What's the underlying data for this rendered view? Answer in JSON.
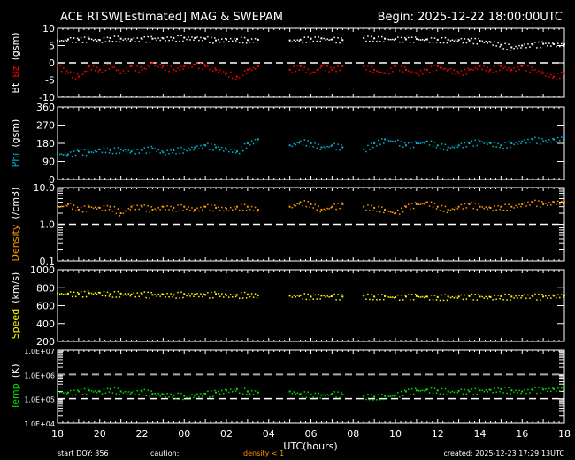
{
  "title": "ACE RTSW[Estimated] MAG & SWEPAM",
  "begin": "Begin: 2025-12-22 18:00:00UTC",
  "footer": {
    "start_doy": "start DOY: 356",
    "caution": "caution:",
    "caution_note": "density < 1",
    "created": "created: 2025-12-23 17:29:13UTC"
  },
  "colors": {
    "bt": "#ffffff",
    "bz": "#ff0000",
    "phi": "#00b4d0",
    "density": "#ff9900",
    "speed": "#ffff00",
    "temp": "#00e000",
    "caution": "#ff9900"
  },
  "chart_data": {
    "type": "scatter",
    "xlabel": "UTC(hours)",
    "x_tick_labels": [
      "18",
      "20",
      "22",
      "00",
      "02",
      "04",
      "06",
      "08",
      "10",
      "12",
      "14",
      "16",
      "18"
    ],
    "x_range": [
      "2025-12-22 18:00",
      "2025-12-23 18:00"
    ],
    "x": [
      "18:00",
      "18:30",
      "19:00",
      "19:30",
      "20:00",
      "20:30",
      "21:00",
      "21:30",
      "22:00",
      "22:30",
      "23:00",
      "23:30",
      "00:00",
      "00:30",
      "01:00",
      "01:30",
      "02:00",
      "02:30",
      "03:00",
      "03:30",
      "04:00",
      "04:30",
      "05:00",
      "05:30",
      "06:00",
      "06:30",
      "07:00",
      "07:30",
      "08:00",
      "08:30",
      "09:00",
      "09:30",
      "10:00",
      "10:30",
      "11:00",
      "11:30",
      "12:00",
      "12:30",
      "13:00",
      "13:30",
      "14:00",
      "14:30",
      "15:00",
      "15:30",
      "16:00",
      "16:30",
      "17:00",
      "17:30",
      "18:00"
    ],
    "panels": [
      {
        "ylabel_parts": [
          "Bt",
          "Bz",
          "(gsm)"
        ],
        "ylim": [
          -10,
          10
        ],
        "scale": "linear",
        "yticks": [
          "10",
          "5",
          "0",
          "-5",
          "-10"
        ],
        "tick_values": [
          10,
          5,
          0,
          -5,
          -10
        ],
        "dashed_line": 0,
        "series": [
          {
            "name": "Bt",
            "color_key": "bt",
            "values": [
              6.5,
              6.8,
              6.7,
              7.0,
              6.6,
              7.2,
              7.0,
              6.8,
              6.9,
              7.0,
              7.1,
              7.2,
              7.3,
              7.2,
              7.0,
              6.5,
              6.8,
              6.9,
              6.6,
              6.7,
              null,
              null,
              6.5,
              6.7,
              7.0,
              7.1,
              6.8,
              6.6,
              null,
              7.2,
              7.1,
              7.0,
              6.9,
              6.8,
              6.9,
              6.8,
              6.7,
              6.7,
              6.6,
              6.5,
              6.4,
              6.0,
              5.2,
              4.5,
              5.0,
              5.3,
              5.5,
              5.4,
              5.3
            ]
          },
          {
            "name": "Bz",
            "color_key": "bz",
            "values": [
              -1,
              -3,
              -4,
              -1,
              -2,
              -0.5,
              -3,
              -1,
              -2,
              0,
              -1,
              -2,
              -1,
              -0.5,
              -1,
              -2,
              -3,
              -4,
              -2,
              -1,
              null,
              null,
              -2,
              -1,
              -3,
              -1,
              -2,
              -1,
              null,
              -1,
              -2,
              -3,
              -1,
              -2,
              -3,
              -2,
              -1,
              -2,
              -3,
              -2,
              -1,
              -2,
              -1,
              -2,
              -1,
              -2,
              -3,
              -4,
              -3
            ]
          }
        ]
      },
      {
        "ylabel_parts": [
          "Phi",
          "(gsm)"
        ],
        "ylim": [
          0,
          360
        ],
        "scale": "linear",
        "yticks": [
          "360",
          "270",
          "180",
          "90",
          "0"
        ],
        "tick_values": [
          360,
          270,
          180,
          90,
          0
        ],
        "series": [
          {
            "name": "Phi",
            "color_key": "phi",
            "values": [
              130,
              125,
              140,
              135,
              150,
              145,
              150,
              140,
              145,
              155,
              135,
              145,
              150,
              160,
              170,
              160,
              150,
              140,
              180,
              200,
              null,
              null,
              170,
              190,
              180,
              160,
              170,
              160,
              null,
              150,
              180,
              200,
              190,
              170,
              180,
              190,
              170,
              160,
              170,
              180,
              190,
              180,
              170,
              180,
              190,
              200,
              190,
              200,
              210
            ]
          }
        ]
      },
      {
        "ylabel_parts": [
          "Density",
          "(/cm3)"
        ],
        "ylim": [
          0.1,
          10
        ],
        "scale": "log",
        "yticks": [
          "10.0",
          "1.0",
          "0.1"
        ],
        "tick_values": [
          10,
          1,
          0.1
        ],
        "dashed_line": 1,
        "series": [
          {
            "name": "Density",
            "color_key": "density",
            "values": [
              3,
              3.5,
              2.5,
              3,
              2.8,
              3,
              2,
              3,
              3,
              2.5,
              3,
              2.8,
              3,
              2.5,
              3,
              2.8,
              2.6,
              3,
              3,
              2.5,
              null,
              null,
              3,
              4,
              3.5,
              2.5,
              3,
              3.5,
              null,
              3,
              2.8,
              2.5,
              2,
              3,
              3.5,
              4,
              3,
              2.5,
              3,
              3.5,
              3,
              2.8,
              3,
              3,
              3.5,
              4,
              3.5,
              4,
              4
            ]
          }
        ]
      },
      {
        "ylabel_parts": [
          "Speed",
          "(km/s)"
        ],
        "ylim": [
          200,
          1000
        ],
        "scale": "linear",
        "yticks": [
          "1000",
          "800",
          "600",
          "400",
          "200"
        ],
        "tick_values": [
          1000,
          800,
          600,
          400,
          200
        ],
        "series": [
          {
            "name": "Speed",
            "color_key": "speed",
            "values": [
              740,
              735,
              730,
              740,
              745,
              730,
              735,
              725,
              730,
              720,
              725,
              720,
              730,
              725,
              720,
              730,
              715,
              720,
              725,
              715,
              null,
              null,
              710,
              715,
              700,
              710,
              705,
              700,
              null,
              710,
              700,
              705,
              695,
              700,
              705,
              700,
              695,
              700,
              700,
              705,
              700,
              695,
              705,
              700,
              710,
              705,
              700,
              710,
              715
            ]
          }
        ]
      },
      {
        "ylabel_parts": [
          "Temp",
          "(K)"
        ],
        "ylim": [
          10000,
          10000000
        ],
        "scale": "log",
        "yticks": [
          "1.0E+07",
          "1.0E+06",
          "1.0E+05",
          "1.0E+04"
        ],
        "tick_values": [
          10000000,
          1000000,
          100000,
          10000
        ],
        "dashed_line": 100000,
        "gray_dashed_line": 1000000,
        "series": [
          {
            "name": "Temp",
            "color_key": "temp",
            "values": [
              200000,
              180000,
              200000,
              220000,
              200000,
              250000,
              200000,
              180000,
              200000,
              160000,
              150000,
              140000,
              130000,
              140000,
              160000,
              180000,
              220000,
              250000,
              200000,
              180000,
              null,
              null,
              200000,
              160000,
              150000,
              140000,
              160000,
              150000,
              null,
              130000,
              120000,
              130000,
              140000,
              200000,
              220000,
              240000,
              220000,
              200000,
              210000,
              200000,
              220000,
              230000,
              250000,
              220000,
              200000,
              230000,
              240000,
              250000,
              260000
            ]
          }
        ]
      }
    ]
  }
}
